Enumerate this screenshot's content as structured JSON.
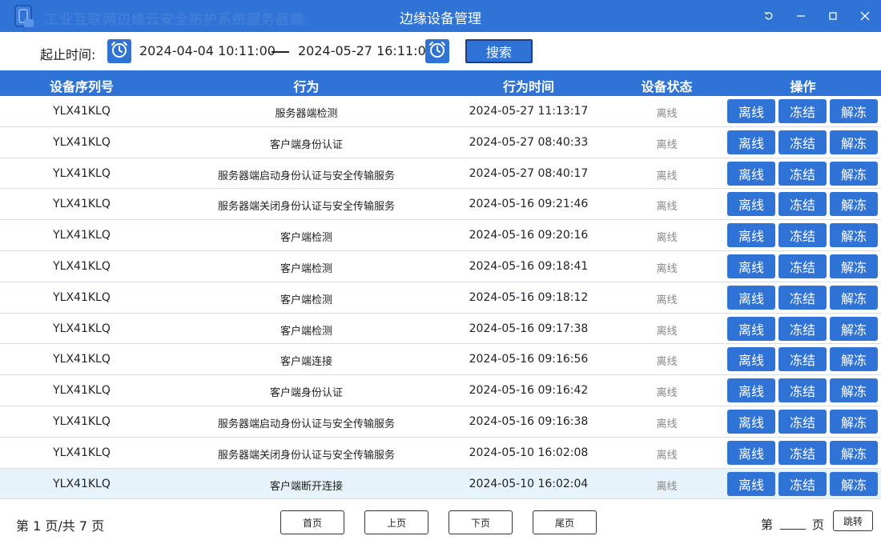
{
  "window": {
    "app_name": "工业互联网边缘云安全防护系统服务器端",
    "title": "边缘设备管理",
    "icons": [
      "app-logo-icon",
      "restore-icon",
      "minimize-icon",
      "maximize-icon",
      "close-icon"
    ]
  },
  "filter": {
    "label": "起止时间:",
    "start": "2024-04-04 10:11:00",
    "end": "2024-05-27 16:11:00",
    "search_label": "搜索",
    "icon": "alarm-clock-icon"
  },
  "table": {
    "columns": [
      "设备序列号",
      "行为",
      "行为时间",
      "设备状态",
      "操作"
    ],
    "op_labels": [
      "离线",
      "冻结",
      "解冻"
    ],
    "rows": [
      {
        "serial": "YLX41KLQ",
        "action": "服务器端检测",
        "time": "2024-05-27 11:13:17",
        "status": "离线"
      },
      {
        "serial": "YLX41KLQ",
        "action": "客户端身份认证",
        "time": "2024-05-27 08:40:33",
        "status": "离线"
      },
      {
        "serial": "YLX41KLQ",
        "action": "服务器端启动身份认证与安全传输服务",
        "time": "2024-05-27 08:40:17",
        "status": "离线"
      },
      {
        "serial": "YLX41KLQ",
        "action": "服务器端关闭身份认证与安全传输服务",
        "time": "2024-05-16 09:21:46",
        "status": "离线"
      },
      {
        "serial": "YLX41KLQ",
        "action": "客户端检测",
        "time": "2024-05-16 09:20:16",
        "status": "离线"
      },
      {
        "serial": "YLX41KLQ",
        "action": "客户端检测",
        "time": "2024-05-16 09:18:41",
        "status": "离线"
      },
      {
        "serial": "YLX41KLQ",
        "action": "客户端检测",
        "time": "2024-05-16 09:18:12",
        "status": "离线"
      },
      {
        "serial": "YLX41KLQ",
        "action": "客户端检测",
        "time": "2024-05-16 09:17:38",
        "status": "离线"
      },
      {
        "serial": "YLX41KLQ",
        "action": "客户端连接",
        "time": "2024-05-16 09:16:56",
        "status": "离线"
      },
      {
        "serial": "YLX41KLQ",
        "action": "客户端身份认证",
        "time": "2024-05-16 09:16:42",
        "status": "离线"
      },
      {
        "serial": "YLX41KLQ",
        "action": "服务器端启动身份认证与安全传输服务",
        "time": "2024-05-16 09:16:38",
        "status": "离线"
      },
      {
        "serial": "YLX41KLQ",
        "action": "服务器端关闭身份认证与安全传输服务",
        "time": "2024-05-10 16:02:08",
        "status": "离线"
      },
      {
        "serial": "YLX41KLQ",
        "action": "客户端断开连接",
        "time": "2024-05-10 16:02:04",
        "status": "离线"
      }
    ],
    "selected_row": 12
  },
  "pagination": {
    "info": "第 1 页/共 7 页",
    "first": "首页",
    "prev": "上页",
    "next": "下页",
    "last": "尾页",
    "goto_prefix": "第",
    "goto_suffix": "页",
    "goto_value": "",
    "jump": "跳转"
  },
  "colors": {
    "accent": "#2f73d6",
    "header_text": "#ffffff",
    "selected_row": "#e6f3fb",
    "status_text": "#888888"
  }
}
